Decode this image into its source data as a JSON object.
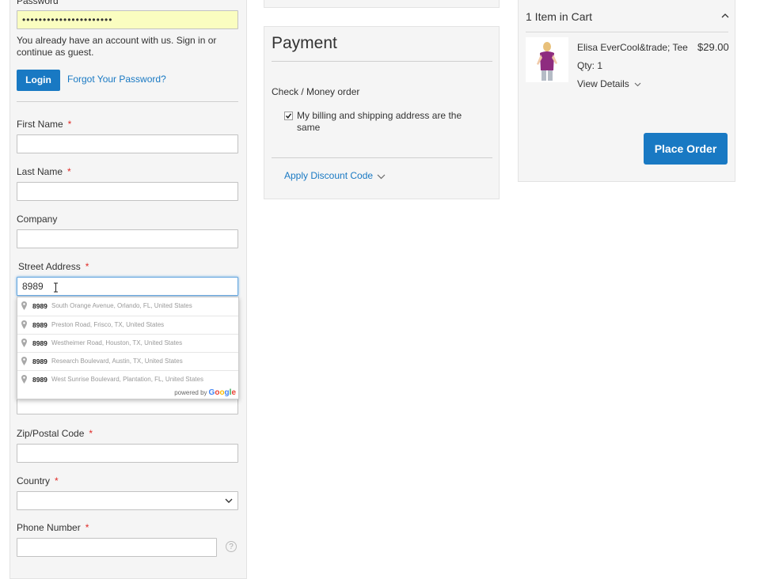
{
  "login": {
    "password_label": "Password",
    "password_value": "••••••••••••••••••••••",
    "account_notice": "You already have an account with us. Sign in or continue as guest.",
    "login_button": "Login",
    "forgot_link": "Forgot Your Password?"
  },
  "form": {
    "first_name_label": "First Name",
    "last_name_label": "Last Name",
    "company_label": "Company",
    "street_label": "Street Address",
    "street_value": "8989",
    "zip_label": "Zip/Postal Code",
    "country_label": "Country",
    "phone_label": "Phone Number",
    "required_mark": "*",
    "help_icon": "?"
  },
  "autocomplete": {
    "items": [
      {
        "number": "8989",
        "address": "South Orange Avenue, Orlando, FL, United States"
      },
      {
        "number": "8989",
        "address": "Preston Road, Frisco, TX, United States"
      },
      {
        "number": "8989",
        "address": "Westheimer Road, Houston, TX, United States"
      },
      {
        "number": "8989",
        "address": "Research Boulevard, Austin, TX, United States"
      },
      {
        "number": "8989",
        "address": "West Sunrise Boulevard, Plantation, FL, United States"
      }
    ],
    "powered_by": "powered by",
    "google": [
      "G",
      "o",
      "o",
      "g",
      "l",
      "e"
    ]
  },
  "payment": {
    "title": "Payment",
    "method": "Check / Money order",
    "same_address_label": "My billing and shipping address are the same",
    "same_address_checked": true,
    "discount_link": "Apply Discount Code"
  },
  "cart": {
    "header": "1 Item in Cart",
    "item_name": "Elisa EverCool&trade; Tee",
    "item_price": "$29.00",
    "qty_label": "Qty: 1",
    "view_details": "View Details",
    "place_order": "Place Order"
  },
  "colors": {
    "primary": "#1979c3",
    "required": "#e02b27",
    "autofill": "#fafdc0"
  }
}
